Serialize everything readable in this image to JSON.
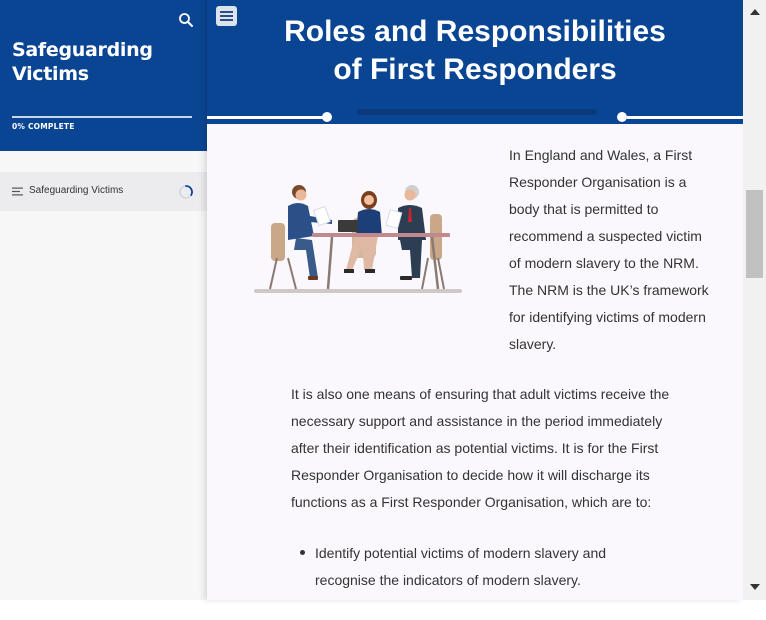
{
  "sidebar": {
    "course_title": "Safeguarding Victims",
    "progress_percent": 0,
    "progress_label": "0% COMPLETE",
    "items": [
      {
        "label": "Safeguarding Victims",
        "icon": "lesson-list-icon",
        "status": "in-progress-spinner"
      }
    ],
    "search_icon": "search-icon"
  },
  "lesson": {
    "title_line1": "Roles and Responsibilities",
    "title_line2": "of First Responders",
    "menu_icon": "hamburger-menu-icon",
    "intro": "In England and Wales, a First Responder Organisation is a body that is permitted to recommend a suspected victim of modern slavery to the NRM. The NRM is the UK’s framework for identifying victims of modern slavery.",
    "paragraph": "It is also one means of ensuring that adult victims receive the necessary support and assistance in the period immediately after their identification as potential victims. It is for the First Responder Organisation to decide how it will discharge its functions as a First Responder Organisation, which are to:",
    "bullets": [
      "Identify potential victims of modern slavery and recognise the indicators of modern slavery."
    ]
  },
  "colors": {
    "brand_blue": "#0a4593",
    "content_bg": "#faf8fc",
    "sidebar_bg": "#f7f7f8"
  }
}
